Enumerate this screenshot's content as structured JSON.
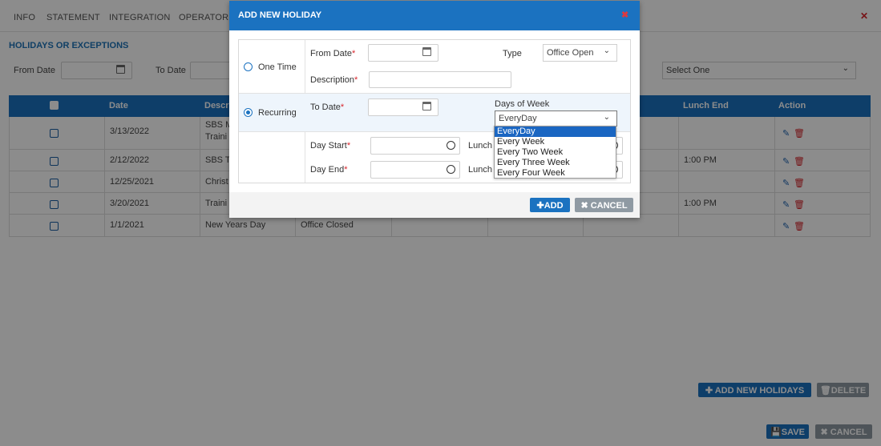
{
  "tabs": [
    "INFO",
    "STATEMENT",
    "INTEGRATION",
    "OPERATORI"
  ],
  "section_title": "HOLIDAYS OR EXCEPTIONS",
  "filters": {
    "from_date_label": "From Date",
    "to_date_label": "To Date",
    "select_value": "Select One"
  },
  "table": {
    "headers": [
      "Date",
      "Descr",
      "Lunch End",
      "Action"
    ],
    "rows": [
      {
        "date": "3/13/2022",
        "desc": "SBS M",
        "desc2": "Traini",
        "extra": "",
        "lunch_end": ""
      },
      {
        "date": "2/12/2022",
        "desc": "SBS T",
        "desc2": "",
        "extra": "",
        "lunch_end": "1:00 PM"
      },
      {
        "date": "12/25/2021",
        "desc": "Christ",
        "desc2": "",
        "extra": "",
        "lunch_end": ""
      },
      {
        "date": "3/20/2021",
        "desc": "Traini",
        "desc2": "",
        "extra": "",
        "lunch_end": "1:00 PM"
      },
      {
        "date": "1/1/2021",
        "desc": "New Years Day",
        "desc2": "",
        "extra": "Office Closed",
        "lunch_end": ""
      }
    ]
  },
  "buttons": {
    "add_new_holidays": "ADD NEW HOLIDAYS",
    "delete": "DELETE",
    "save": "SAVE",
    "cancel": "CANCEL"
  },
  "modal": {
    "title": "ADD NEW HOLIDAY",
    "one_time_label": "One Time",
    "recurring_label": "Recurring",
    "from_date_label": "From Date",
    "type_label": "Type",
    "type_value": "Office Open",
    "description_label": "Description",
    "to_date_label": "To Date",
    "days_of_week_label": "Days of Week",
    "days_of_week_value": "EveryDay",
    "day_start_label": "Day Start",
    "day_end_label": "Day End",
    "lunch_label": "Lunch",
    "required_mark": "*",
    "add_button": "ADD",
    "cancel_button": "CANCEL",
    "dropdown_options": [
      "EveryDay",
      "Every Week",
      "Every Two Week",
      "Every Three Week",
      "Every Four Week"
    ]
  },
  "colors": {
    "primary": "#1b72c0",
    "danger": "#d9262c",
    "overlay": "rgba(0,0,0,0.45)"
  }
}
